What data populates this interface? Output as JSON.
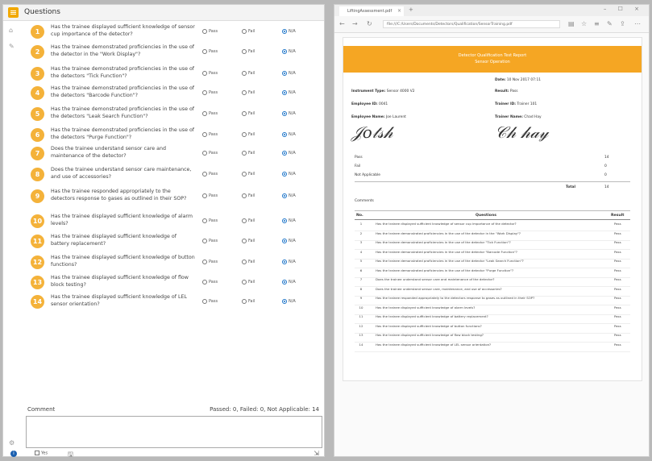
{
  "left": {
    "title": "Questions",
    "options": {
      "pass": "Pass",
      "fail": "Fail",
      "na": "N/A"
    },
    "questions": [
      {
        "num": "1",
        "text": "Has the trainee displayed sufficient knowledge of sensor cup importance of the detector?"
      },
      {
        "num": "2",
        "text": "Has the trainee demonstrated proficiencies in the use of the detector in the \"Work Display\"?"
      },
      {
        "num": "3",
        "text": "Has the trainee demonstrated proficiencies in the use of the detectors \"Tick Function\"?"
      },
      {
        "num": "4",
        "text": "Has the trainee demonstrated proficiencies in the use of the detectors \"Barcode Function\"?"
      },
      {
        "num": "5",
        "text": "Has the trainee demonstrated proficiencies in the use of the detectors \"Leak Search Function\"?"
      },
      {
        "num": "6",
        "text": "Has the trainee demonstrated proficiencies in the use of the detectors \"Purge Function\"?"
      },
      {
        "num": "7",
        "text": "Does the trainee understand sensor care and maintenance of the detector?"
      },
      {
        "num": "8",
        "text": "Does the trainee understand sensor care maintenance, and use of accessories?"
      },
      {
        "num": "9",
        "text": "Has the trainee responded appropriately to the detectors response to gases as outlined in their SOP?"
      },
      {
        "num": "10",
        "text": "Has the trainee displayed sufficient knowledge of alarm levels?"
      },
      {
        "num": "11",
        "text": "Has the trainee displayed sufficient knowledge of battery replacement?"
      },
      {
        "num": "12",
        "text": "Has the trainee displayed sufficient knowledge of button functions?"
      },
      {
        "num": "13",
        "text": "Has the trainee displayed sufficient knowledge of flow block testing?"
      },
      {
        "num": "14",
        "text": "Has the trainee displayed sufficient knowledge of LEL sensor orientation?"
      }
    ],
    "comment_label": "Comment",
    "summary": "Passed: 0, Failed: 0, Not Applicable: 14",
    "bottom_check_label": "Yes"
  },
  "browser": {
    "tab_title": "LiftingAssessment.pdf",
    "url": "file:///C:/Users/Documents/Detectors/Qualification/SensorTraining.pdf",
    "report": {
      "title": "Detector Qualification Test Report",
      "subtitle": "Sensor Operation",
      "date_label": "Date:",
      "date_value": "10 Nov 2017 07:11",
      "instrument_label": "Instrument Type:",
      "instrument_value": "Sensor 4000 V2",
      "result_label": "Result:",
      "result_value": "Pass",
      "employee_id_label": "Employee ID:",
      "employee_id_value": "0041",
      "trainer_id_label": "Trainer ID:",
      "trainer_id_value": "Trainer 101",
      "employee_name_label": "Employee Name:",
      "employee_name_value": "Joe Laurent",
      "trainer_name_label": "Trainer Name:",
      "trainer_name_value": "Chad Hay",
      "sig_employee": "Joe Laurent",
      "sig_trainer": "Chad Hay",
      "counts": [
        {
          "label": "Pass",
          "value": "14"
        },
        {
          "label": "Fail",
          "value": "0"
        },
        {
          "label": "Not Applicable",
          "value": "0"
        }
      ],
      "total_label": "Total",
      "total_value": "14",
      "comments_label": "Comments",
      "table_headers": {
        "no": "No.",
        "question": "Questions",
        "result": "Result"
      },
      "rows": [
        {
          "no": "1",
          "q": "Has the trainee displayed sufficient knowledge of sensor cup importance of the detector?",
          "r": "Pass"
        },
        {
          "no": "2",
          "q": "Has the trainee demonstrated proficiencies in the use of the detector in the \"Work Display\"?",
          "r": "Pass"
        },
        {
          "no": "3",
          "q": "Has the trainee demonstrated proficiencies in the use of the detector \"Tick Function\"?",
          "r": "Pass"
        },
        {
          "no": "4",
          "q": "Has the trainee demonstrated proficiencies in the use of the detector \"Barcode Function\"?",
          "r": "Pass"
        },
        {
          "no": "5",
          "q": "Has the trainee demonstrated proficiencies in the use of the detector \"Leak Search Function\"?",
          "r": "Pass"
        },
        {
          "no": "6",
          "q": "Has the trainee demonstrated proficiencies in the use of the detector \"Purge Function\"?",
          "r": "Pass"
        },
        {
          "no": "7",
          "q": "Does the trainee understand sensor care and maintenance of the detector?",
          "r": "Pass"
        },
        {
          "no": "8",
          "q": "Does the trainee understand sensor care, maintenance, and use of accessories?",
          "r": "Pass"
        },
        {
          "no": "9",
          "q": "Has the trainee responded appropriately to the detectors response to gases as outlined in their SOP?",
          "r": "Pass"
        },
        {
          "no": "10",
          "q": "Has the trainee displayed sufficient knowledge of alarm levels?",
          "r": "Pass"
        },
        {
          "no": "11",
          "q": "Has the trainee displayed sufficient knowledge of battery replacement?",
          "r": "Pass"
        },
        {
          "no": "12",
          "q": "Has the trainee displayed sufficient knowledge of button functions?",
          "r": "Pass"
        },
        {
          "no": "13",
          "q": "Has the trainee displayed sufficient knowledge of flow block testing?",
          "r": "Pass"
        },
        {
          "no": "14",
          "q": "Has the trainee displayed sufficient knowledge of LEL sensor orientation?",
          "r": "Pass"
        }
      ]
    }
  },
  "colors": {
    "accent": "#f5a623",
    "number_badge": "#f4b23a",
    "radio_selected": "#1a73c9"
  }
}
